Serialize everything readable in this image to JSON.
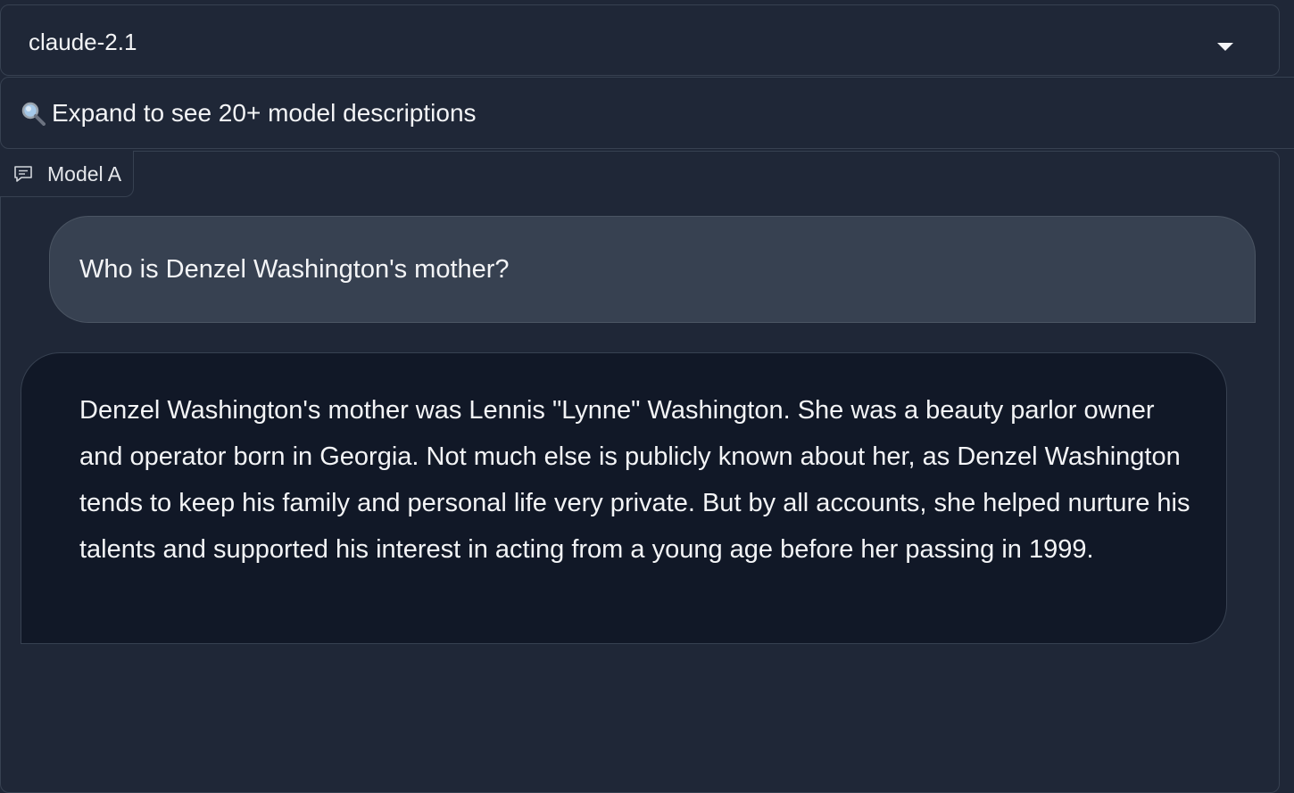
{
  "model_selector": {
    "selected": "claude-2.1"
  },
  "descriptions_accordion": {
    "label": "Expand to see 20+ model descriptions",
    "icon": "magnifying-glass-icon"
  },
  "chatbot": {
    "tab_label": "Model A",
    "tab_icon": "chat-bubble-icon",
    "messages": [
      {
        "role": "user",
        "text": "Who is Denzel Washington's mother?"
      },
      {
        "role": "assistant",
        "text": "Denzel Washington's mother was Lennis \"Lynne\" Washington. She was a beauty parlor owner and operator born in Georgia. Not much else is publicly known about her, as Denzel Washington tends to keep his family and personal life very private. But by all accounts, she helped nurture his talents and supported his interest in acting from a young age before her passing in 1999."
      }
    ]
  },
  "colors": {
    "background": "#1f2737",
    "user_bubble": "#374151",
    "assistant_bubble": "#111827",
    "border": "#374151",
    "text": "#f3f4f6"
  }
}
